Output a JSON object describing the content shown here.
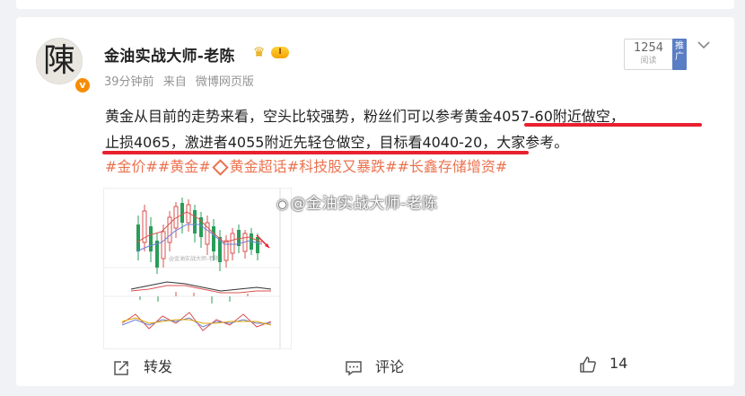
{
  "post": {
    "author": "金油实战大师-老陈",
    "avatar_char": "陳",
    "verified_badge": "v",
    "level_badge": "I",
    "time": "39分钟前",
    "source_prefix": "来自",
    "source": "微博网页版",
    "read_count": "1254",
    "read_label": "阅读",
    "promote_label": "推广",
    "text_line1_plain": "黄金从目前的走势来看，空头比较强势，粉丝们可以参考",
    "text_line1_highlight": "黄金4057-60附近做空，",
    "text_line2_highlight": "止损4065，激进者4055附近先轻仓做空，目标看4040-20",
    "text_line2_plain": "，大家参考。",
    "tags": [
      "#金价#",
      "#黄金#",
      "黄金超话",
      "#科技股又暴跌#",
      "#长鑫存储增资#"
    ],
    "image_watermark": "@金油实战大师-老陈",
    "chart_watermark": "@金油实战大师-老陈"
  },
  "actions": {
    "repost": "转发",
    "comment": "评论",
    "like_count": "14"
  },
  "colors": {
    "tag": "#eb7350",
    "underline": "#e8202f",
    "promo": "#5a7ec3",
    "badge": "#f78c00"
  }
}
